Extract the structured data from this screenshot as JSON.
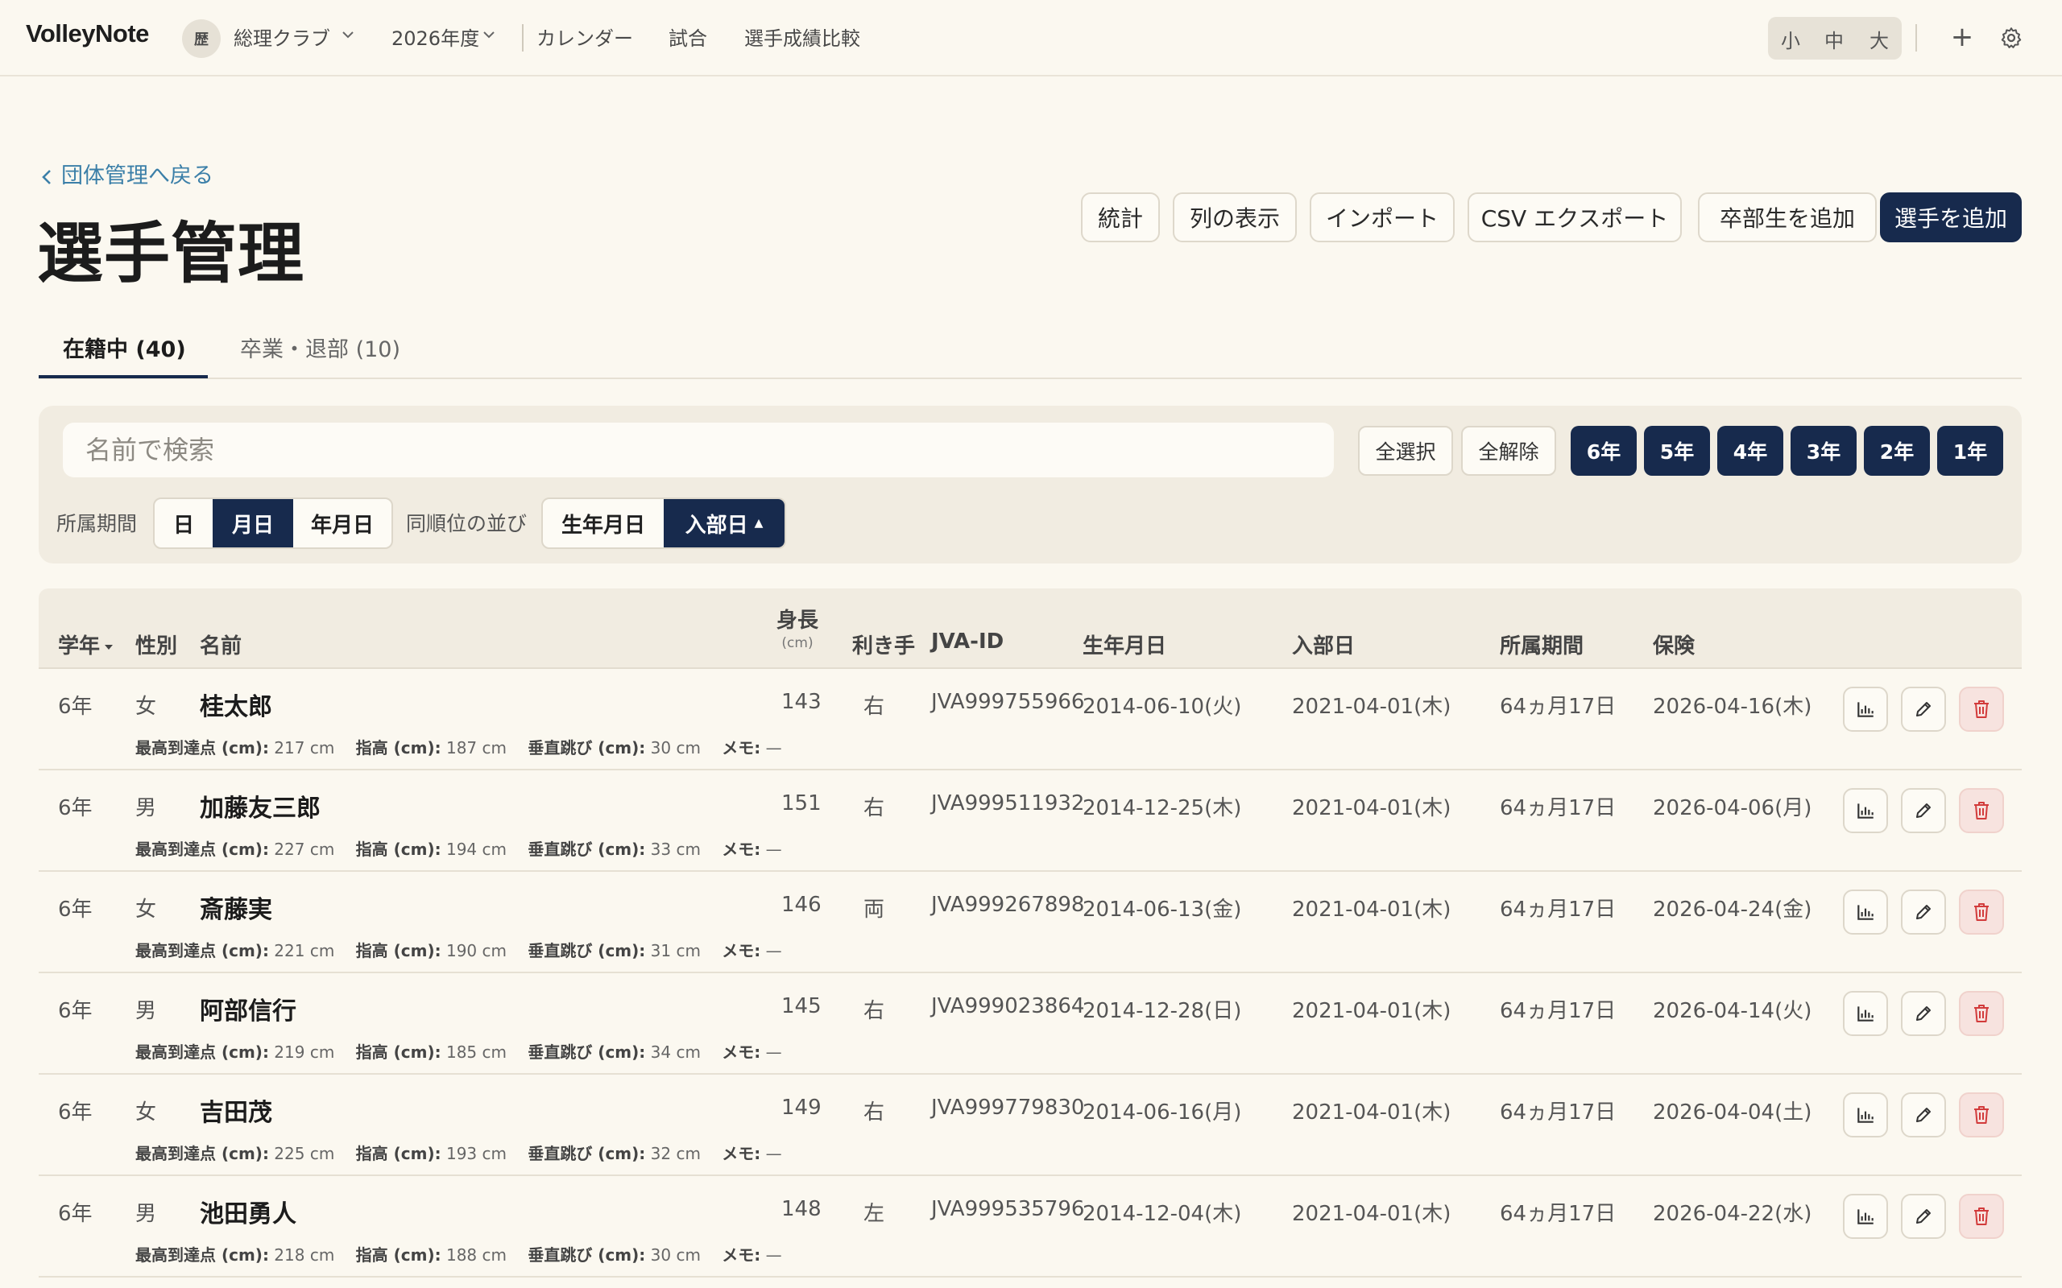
{
  "header": {
    "logo": "VolleyNote",
    "club_avatar": "歴",
    "club_name": "総理クラブ",
    "year": "2026年度",
    "nav": [
      "カレンダー",
      "試合",
      "選手成績比較"
    ],
    "font_sizes": [
      "小",
      "中",
      "大"
    ],
    "plus_label": "+"
  },
  "page": {
    "back_link": "団体管理へ戻る",
    "title": "選手管理",
    "actions": [
      "統計",
      "列の表示",
      "インポート",
      "CSV エクスポート",
      "卒部生を追加",
      "選手を追加"
    ]
  },
  "tabs": [
    {
      "label": "在籍中 (40)"
    },
    {
      "label": "卒業・退部 (10)"
    }
  ],
  "filters": {
    "search_placeholder": "名前で検索",
    "select_all": "全選択",
    "deselect_all": "全解除",
    "grades": [
      "6年",
      "5年",
      "4年",
      "3年",
      "2年",
      "1年"
    ],
    "period_label": "所属期間",
    "period_options": [
      "日",
      "月日",
      "年月日"
    ],
    "period_selected": "月日",
    "sort_label": "同順位の並び",
    "sort_options": [
      "生年月日",
      "入部日"
    ],
    "sort_selected": "入部日",
    "sort_arrow": "▲"
  },
  "table": {
    "headers": {
      "grade": "学年",
      "gender": "性別",
      "name": "名前",
      "height": "身長",
      "height_unit": "(cm)",
      "hand": "利き手",
      "jva": "JVA-ID",
      "birth": "生年月日",
      "join": "入部日",
      "period": "所属期間",
      "insurance": "保険"
    },
    "sub_labels": {
      "reach": "最高到達点 (cm):",
      "standing": "指高 (cm):",
      "jump": "垂直跳び (cm):",
      "memo": "メモ:"
    },
    "rows": [
      {
        "grade": "6年",
        "gender": "女",
        "name": "桂太郎",
        "height": "143",
        "hand": "右",
        "jva": "JVA999755966",
        "birth": "2014-06-10(火)",
        "join": "2021-04-01(木)",
        "period": "64ヵ月17日",
        "insurance": "2026-04-16(木)",
        "reach": "217 cm",
        "standing": "187 cm",
        "jump": "30 cm",
        "memo": "—"
      },
      {
        "grade": "6年",
        "gender": "男",
        "name": "加藤友三郎",
        "height": "151",
        "hand": "右",
        "jva": "JVA999511932",
        "birth": "2014-12-25(木)",
        "join": "2021-04-01(木)",
        "period": "64ヵ月17日",
        "insurance": "2026-04-06(月)",
        "reach": "227 cm",
        "standing": "194 cm",
        "jump": "33 cm",
        "memo": "—"
      },
      {
        "grade": "6年",
        "gender": "女",
        "name": "斎藤実",
        "height": "146",
        "hand": "両",
        "jva": "JVA999267898",
        "birth": "2014-06-13(金)",
        "join": "2021-04-01(木)",
        "period": "64ヵ月17日",
        "insurance": "2026-04-24(金)",
        "reach": "221 cm",
        "standing": "190 cm",
        "jump": "31 cm",
        "memo": "—"
      },
      {
        "grade": "6年",
        "gender": "男",
        "name": "阿部信行",
        "height": "145",
        "hand": "右",
        "jva": "JVA999023864",
        "birth": "2014-12-28(日)",
        "join": "2021-04-01(木)",
        "period": "64ヵ月17日",
        "insurance": "2026-04-14(火)",
        "reach": "219 cm",
        "standing": "185 cm",
        "jump": "34 cm",
        "memo": "—"
      },
      {
        "grade": "6年",
        "gender": "女",
        "name": "吉田茂",
        "height": "149",
        "hand": "右",
        "jva": "JVA999779830",
        "birth": "2014-06-16(月)",
        "join": "2021-04-01(木)",
        "period": "64ヵ月17日",
        "insurance": "2026-04-04(土)",
        "reach": "225 cm",
        "standing": "193 cm",
        "jump": "32 cm",
        "memo": "—"
      },
      {
        "grade": "6年",
        "gender": "男",
        "name": "池田勇人",
        "height": "148",
        "hand": "左",
        "jva": "JVA999535796",
        "birth": "2014-12-04(木)",
        "join": "2021-04-01(木)",
        "period": "64ヵ月17日",
        "insurance": "2026-04-22(水)",
        "reach": "218 cm",
        "standing": "188 cm",
        "jump": "30 cm",
        "memo": "—"
      }
    ]
  },
  "colors": {
    "background": "#fbf8f0",
    "primary": "#172a4d",
    "link": "#3b7fa8",
    "danger": "#d23b3b"
  }
}
